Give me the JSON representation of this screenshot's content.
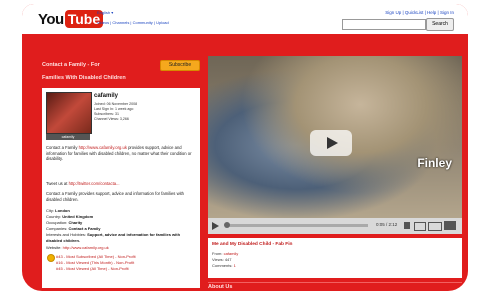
{
  "header": {
    "logo_you": "You",
    "logo_tube": "Tube",
    "language": "English ▾",
    "nav": "Videos | Channels | Community | Upload",
    "user_links": "Sign Up  |  QuickList  |  Help  |  Sign In",
    "search_button": "Search"
  },
  "channel": {
    "title_line1": "Contact a Family - For",
    "title_line2": "Families With Disabled Children",
    "subscribe_label": "Subscribe",
    "username": "cafamily",
    "joined": "Joined: 06 November 2008",
    "last_sign_in": "Last Sign In: 1 week ago",
    "subscribers": "Subscribers: 31",
    "channel_views": "Channel Views: 3,266",
    "avatar_caption": "cafamily",
    "description_prefix": "Contact a Family ",
    "description_link": "http://www.cafamily.org.uk",
    "description_suffix": " provides support, advice and information for families with disabled children, no matter what their condition or disability.",
    "twitter_prefix": "Tweet us at ",
    "twitter_link": "http://twitter.com/contacta...",
    "description2": "Contact a Family provides support, advice and information for families with disabled children.",
    "fields": [
      {
        "label": "City: ",
        "value": "London"
      },
      {
        "label": "Country: ",
        "value": "United Kingdom"
      },
      {
        "label": "Occupation: ",
        "value": "Charity"
      },
      {
        "label": "Companies: ",
        "value": "Contact a Family"
      },
      {
        "label": "Interests and Hobbies: ",
        "value": "Support, advice and information for families with disabled children."
      }
    ],
    "website_label": "Website: ",
    "website": "http://www.cafamily.org.uk",
    "awards": [
      "#43 - Most Subscribed (All Time) - Non-Profit",
      "#16 - Most Viewed (This Month) - Non-Profit",
      "#45 - Most Viewed (All Time) - Non-Profit"
    ]
  },
  "video": {
    "overlay_text": "Finley",
    "time": "0:05 / 2:12",
    "title": "Me and My Disabled Child - Fab Fin",
    "from_label": "From: ",
    "from_value": "cafamily",
    "views": "Views: 447",
    "comments_label": "Comments: ",
    "comments_value": "1"
  },
  "about_heading": "About Us",
  "colors": {
    "brand_red": "#e01d1d",
    "subscribe_orange": "#f5a81d",
    "link_red": "#c01a1a"
  }
}
